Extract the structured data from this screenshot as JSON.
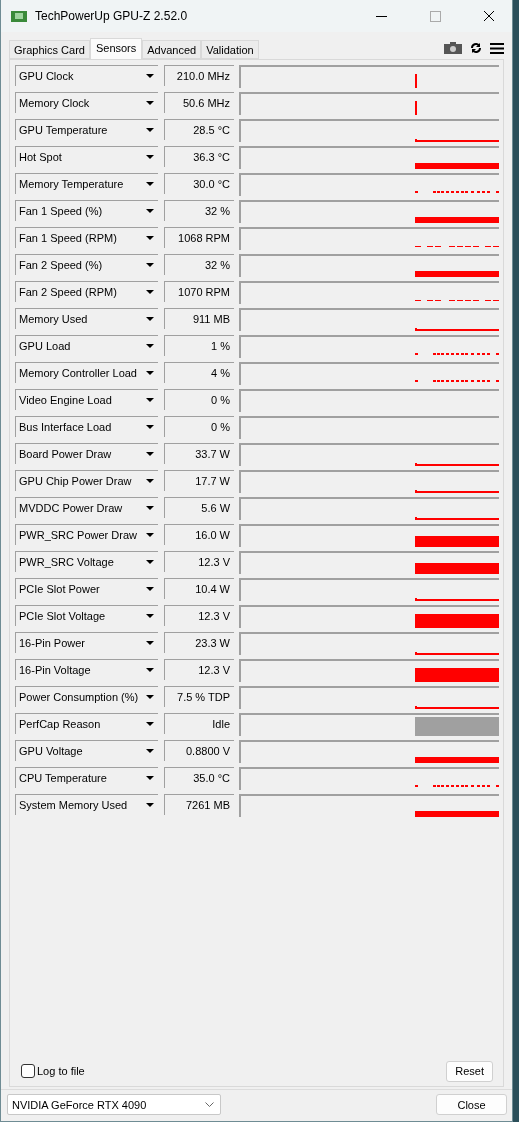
{
  "window": {
    "title": "TechPowerUp GPU-Z 2.52.0"
  },
  "tabs": [
    {
      "label": "Graphics Card",
      "selected": false
    },
    {
      "label": "Sensors",
      "selected": true
    },
    {
      "label": "Advanced",
      "selected": false
    },
    {
      "label": "Validation",
      "selected": false
    }
  ],
  "sensors": [
    {
      "name": "GPU Clock",
      "value": "210.0 MHz",
      "kind": "spike"
    },
    {
      "name": "Memory Clock",
      "value": "50.6 MHz",
      "kind": "spike"
    },
    {
      "name": "GPU Temperature",
      "value": "28.5 °C",
      "kind": "thin"
    },
    {
      "name": "Hot Spot",
      "value": "36.3 °C",
      "kind": "low"
    },
    {
      "name": "Memory Temperature",
      "value": "30.0 °C",
      "kind": "dots"
    },
    {
      "name": "Fan 1 Speed (%)",
      "value": "32 %",
      "kind": "low"
    },
    {
      "name": "Fan 1 Speed (RPM)",
      "value": "1068 RPM",
      "kind": "dashed"
    },
    {
      "name": "Fan 2 Speed (%)",
      "value": "32 %",
      "kind": "low"
    },
    {
      "name": "Fan 2 Speed (RPM)",
      "value": "1070 RPM",
      "kind": "dashed"
    },
    {
      "name": "Memory Used",
      "value": "911 MB",
      "kind": "thin"
    },
    {
      "name": "GPU Load",
      "value": "1 %",
      "kind": "dots"
    },
    {
      "name": "Memory Controller Load",
      "value": "4 %",
      "kind": "dots"
    },
    {
      "name": "Video Engine Load",
      "value": "0 %",
      "kind": "none"
    },
    {
      "name": "Bus Interface Load",
      "value": "0 %",
      "kind": "none"
    },
    {
      "name": "Board Power Draw",
      "value": "33.7 W",
      "kind": "thin"
    },
    {
      "name": "GPU Chip Power Draw",
      "value": "17.7 W",
      "kind": "thin"
    },
    {
      "name": "MVDDC Power Draw",
      "value": "5.6 W",
      "kind": "thin"
    },
    {
      "name": "PWR_SRC Power Draw",
      "value": "16.0 W",
      "kind": "high"
    },
    {
      "name": "PWR_SRC Voltage",
      "value": "12.3 V",
      "kind": "high"
    },
    {
      "name": "PCIe Slot Power",
      "value": "10.4 W",
      "kind": "thin"
    },
    {
      "name": "PCIe Slot Voltage",
      "value": "12.3 V",
      "kind": "full"
    },
    {
      "name": "16-Pin Power",
      "value": "23.3 W",
      "kind": "thin"
    },
    {
      "name": "16-Pin Voltage",
      "value": "12.3 V",
      "kind": "full"
    },
    {
      "name": "Power Consumption (%)",
      "value": "7.5 % TDP",
      "kind": "thin"
    },
    {
      "name": "PerfCap Reason",
      "value": "Idle",
      "kind": "gray"
    },
    {
      "name": "GPU Voltage",
      "value": "0.8800 V",
      "kind": "low"
    },
    {
      "name": "CPU Temperature",
      "value": "35.0 °C",
      "kind": "dots"
    },
    {
      "name": "System Memory Used",
      "value": "7261 MB",
      "kind": "low"
    }
  ],
  "log_to_file": {
    "label": "Log to file",
    "checked": false
  },
  "reset_button": "Reset",
  "gpu_select": {
    "value": "NVIDIA GeForce RTX 4090"
  },
  "close_button": "Close"
}
